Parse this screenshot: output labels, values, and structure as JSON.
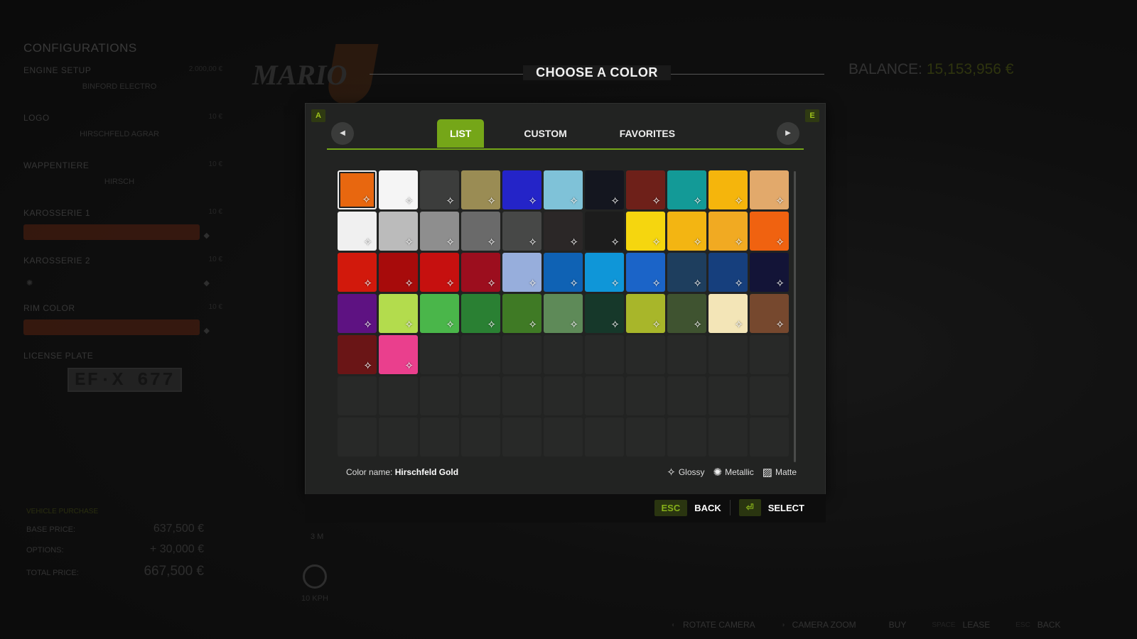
{
  "config": {
    "title": "CONFIGURATIONS",
    "rows": [
      {
        "label": "ENGINE SETUP",
        "price": "2.000,00 €",
        "value": "BINFORD ELECTRO"
      },
      {
        "label": "LOGO",
        "price": "10 €",
        "value": "HIRSCHFELD AGRAR"
      },
      {
        "label": "WAPPENTIERE",
        "price": "10 €",
        "value": "HIRSCH"
      },
      {
        "label": "KAROSSERIE 1",
        "price": "10 €",
        "value": ""
      },
      {
        "label": "KAROSSERIE 2",
        "price": "10 €",
        "value": ""
      },
      {
        "label": "RIM COLOR",
        "price": "10 €",
        "value": ""
      }
    ],
    "license_label": "LICENSE PLATE",
    "license_value": "EF·X 677"
  },
  "prices": {
    "header": "VEHICLE PURCHASE",
    "base_label": "BASE PRICE:",
    "base_value": "637,500 €",
    "options_label": "OPTIONS:",
    "options_value": "+ 30,000 €",
    "total_label": "TOTAL PRICE:",
    "total_value": "667,500 €"
  },
  "balance": {
    "label": "BALANCE:",
    "value": "15,153,956 €"
  },
  "speed_label": "10 KPH",
  "length_label": "3 M",
  "logo_text": "MARIO",
  "modal": {
    "title": "CHOOSE A COLOR",
    "key_left": "A",
    "key_right": "E",
    "tabs": [
      "LIST",
      "CUSTOM",
      "FAVORITES"
    ],
    "active_tab": "LIST",
    "color_name_label": "Color name:",
    "color_name_value": "Hirschfeld Gold",
    "legend": {
      "glossy": "Glossy",
      "metallic": "Metallic",
      "matte": "Matte"
    },
    "footer": {
      "esc_key": "ESC",
      "back": "BACK",
      "select": "SELECT"
    },
    "swatches": [
      "#e8670f",
      "#f5f5f5",
      "#3c3d3c",
      "#9a8c54",
      "#2424c8",
      "#7fc2d8",
      "#14161f",
      "#6e2019",
      "#139a97",
      "#f5b50c",
      "#e2a96b",
      "#f0f0f0",
      "#bbbbbb",
      "#8e8e8e",
      "#6a6a6a",
      "#474847",
      "#2b2727",
      "#1c1c1c",
      "#f5d60f",
      "#f3b512",
      "#f1aa22",
      "#f06210",
      "#d2190c",
      "#a70b0b",
      "#c6100f",
      "#9c0e1e",
      "#97aedc",
      "#0f62b4",
      "#0f96d8",
      "#1b64c8",
      "#1e3e5e",
      "#163f7d",
      "#131437",
      "#5e1282",
      "#b3dc4d",
      "#4ab64a",
      "#2a8033",
      "#3f7a25",
      "#5e8a58",
      "#16382a",
      "#a8b62a",
      "#3f5330",
      "#f3e5b7",
      "#76482e",
      "#6a1516",
      "#ea3f8d"
    ],
    "selected_index": 0,
    "total_slots": 77
  },
  "hints": [
    {
      "key": "◐",
      "label": "ROTATE CAMERA"
    },
    {
      "key": "◑",
      "label": "CAMERA ZOOM"
    },
    {
      "key": "",
      "label": "BUY"
    },
    {
      "key": "SPACE",
      "label": "LEASE"
    },
    {
      "key": "ESC",
      "label": "BACK"
    }
  ]
}
